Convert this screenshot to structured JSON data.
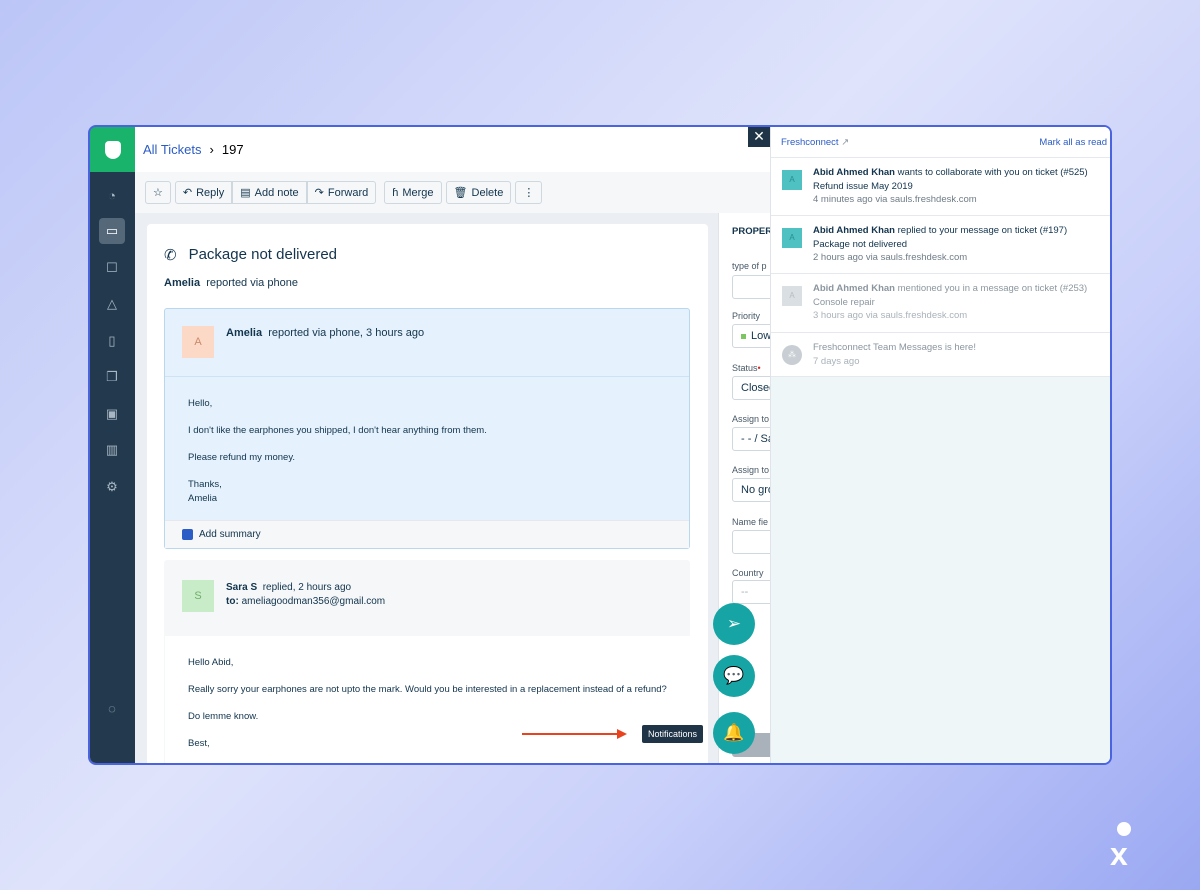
{
  "breadcrumb": {
    "parent": "All Tickets",
    "current": "197"
  },
  "toolbar": {
    "reply": "Reply",
    "add_note": "Add note",
    "forward": "Forward",
    "merge": "Merge",
    "delete": "Delete",
    "more": "⋮"
  },
  "ticket": {
    "title": "Package not delivered",
    "reporter": "Amelia",
    "reported_via": "reported via phone"
  },
  "messages": [
    {
      "avatar": "A",
      "author": "Amelia",
      "meta": "reported via phone, 3 hours ago",
      "lines": [
        "Hello,",
        "I don't like the earphones you shipped, I don't hear anything from them.",
        "Please refund my money.",
        "Thanks,",
        "Amelia"
      ],
      "summary": "Add summary"
    },
    {
      "avatar": "S",
      "author": "Sara S",
      "meta": "replied, 2 hours ago",
      "to_label": "to:",
      "to": "ameliagoodman356@gmail.com",
      "lines": [
        "Hello Abid,",
        "Really sorry your earphones are not upto the mark. Would you be interested in a replacement instead of a refund?",
        "Do lemme know.",
        "Best,"
      ]
    }
  ],
  "properties": {
    "heading": "PROPERTIES",
    "fields": [
      {
        "label": "type of p",
        "value": ""
      },
      {
        "label": "Priority",
        "value": "Low"
      },
      {
        "label": "Status",
        "value": "Closed"
      },
      {
        "label": "Assign to",
        "value": "- - / Sa"
      },
      {
        "label": "Assign to",
        "value": "No gro"
      },
      {
        "label": "Name fie",
        "value": ""
      },
      {
        "label": "Country",
        "value": "--"
      }
    ]
  },
  "notifications": {
    "source": "Freshconnect",
    "mark_all": "Mark all as read",
    "items": [
      {
        "avatar": "A",
        "name": "Abid Ahmed Khan",
        "text": " wants to collaborate with you on ticket (#525) Refund issue May 2019",
        "meta": "4 minutes ago via sauls.freshdesk.com",
        "read": false
      },
      {
        "avatar": "A",
        "name": "Abid Ahmed Khan",
        "text": " replied to your message on ticket (#197) Package not delivered",
        "meta": "2 hours ago via sauls.freshdesk.com",
        "read": false
      },
      {
        "avatar": "A",
        "name": "Abid Ahmed Khan",
        "text": " mentioned you in a message on ticket (#253) Console repair",
        "meta": "3 hours ago via sauls.freshdesk.com",
        "read": true
      },
      {
        "avatar": "",
        "name": "",
        "text": "Freshconnect Team Messages is here!",
        "meta": "7 days ago",
        "read": true
      }
    ]
  },
  "tooltip": "Notifications",
  "colors": {
    "accent": "#16a5a4",
    "brand": "#19b36b",
    "sidebar": "#233a4e",
    "arrow": "#e8421f"
  }
}
